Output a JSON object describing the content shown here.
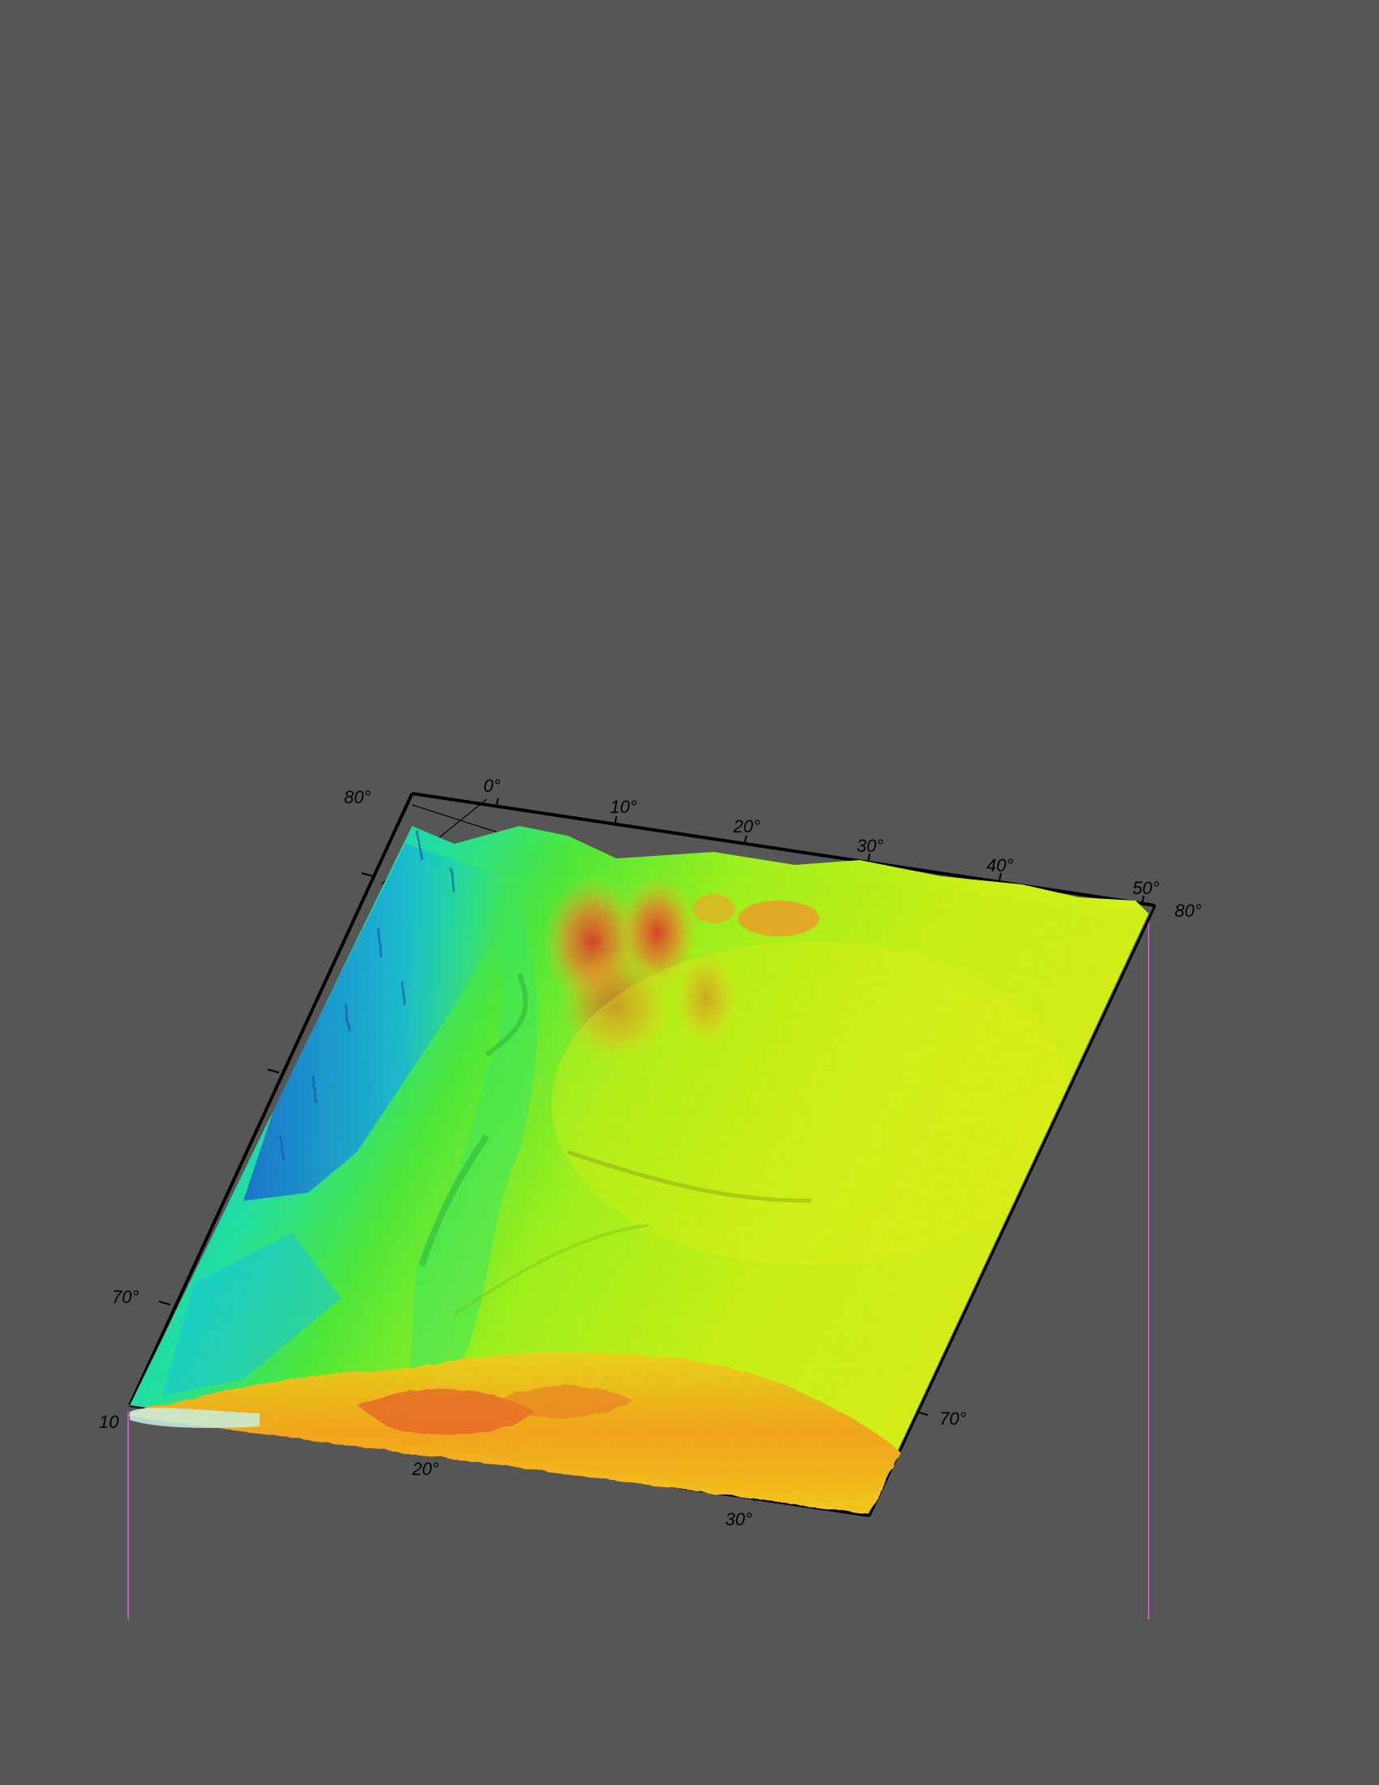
{
  "map": {
    "projection": "perspective 3D relief",
    "colormap": [
      "#2a6fd6",
      "#18c8e8",
      "#22e87a",
      "#8ef01a",
      "#e6f21a",
      "#f2c21a",
      "#f07a28",
      "#d8282a"
    ],
    "background_color": "#565656",
    "frame_color": "#000000",
    "vertical_guide_color": "#c05cc0"
  },
  "labels": {
    "top_lat_left": "80°",
    "top_lon_0": "0°",
    "top_lon_10": "10°",
    "top_lon_20": "20°",
    "top_lon_30": "30°",
    "top_lon_40": "40°",
    "top_lon_50": "50°",
    "top_lat_right": "80°",
    "left_lat_70": "70°",
    "bottom_left_corner": "10",
    "bottom_lon_20": "20°",
    "bottom_lon_30": "30°",
    "right_lat_70": "70°"
  }
}
